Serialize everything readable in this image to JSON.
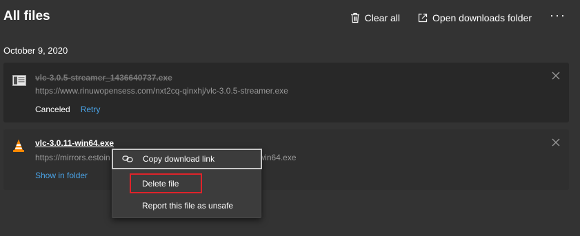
{
  "header": {
    "title": "All files",
    "clear_all_label": "Clear all",
    "open_folder_label": "Open downloads folder",
    "more_label": "···"
  },
  "date_group": "October 9, 2020",
  "downloads": [
    {
      "name": "vlc-3.0.5-streamer_1436640737.exe",
      "url": "https://www.rinuwopensess.com/nxt2cq-qinxhj/vlc-3.0.5-streamer.exe",
      "status": "Canceled",
      "action": "Retry",
      "icon": "installer-file-icon"
    },
    {
      "name": "vlc-3.0.11-win64.exe",
      "url_start": "https://mirrors.estoin",
      "url_end": ".11-win64.exe",
      "action": "Show in folder",
      "icon": "vlc-cone-icon"
    }
  ],
  "context_menu": {
    "items": [
      {
        "label": "Copy download link",
        "icon": "link-icon"
      },
      {
        "label": "Delete file"
      },
      {
        "label": "Report this file as unsafe"
      }
    ]
  },
  "colors": {
    "background": "#333333",
    "card": "#282828",
    "link": "#4aa3e6",
    "highlight": "#e0232a"
  }
}
